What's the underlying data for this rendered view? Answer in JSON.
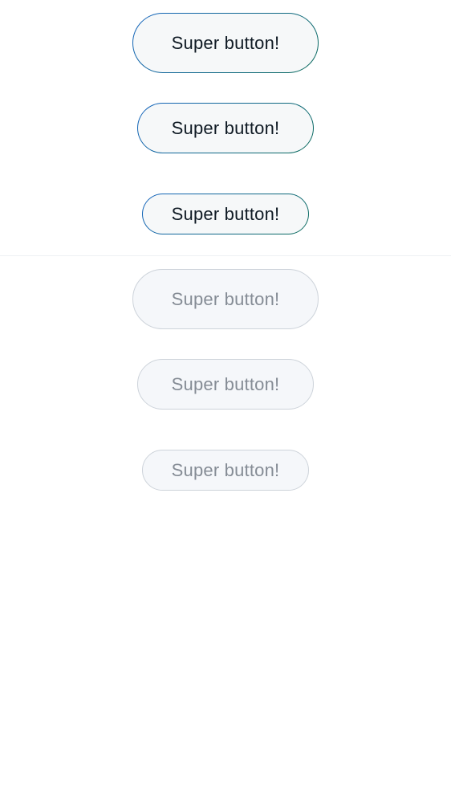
{
  "enabled_buttons": {
    "large_label": "Super button!",
    "medium_label": "Super button!",
    "small_label": "Super button!"
  },
  "disabled_buttons": {
    "large_label": "Super button!",
    "medium_label": "Super button!",
    "small_label": "Super button!"
  },
  "colors": {
    "enabled_text": "#0f1a24",
    "enabled_border_start": "#1565c0",
    "enabled_border_end": "#0b6b5b",
    "enabled_fill": "#f6f8f9",
    "disabled_text": "#858c95",
    "disabled_border": "#cdd3da",
    "disabled_fill": "#f5f7fa",
    "divider": "#edf0f3"
  }
}
